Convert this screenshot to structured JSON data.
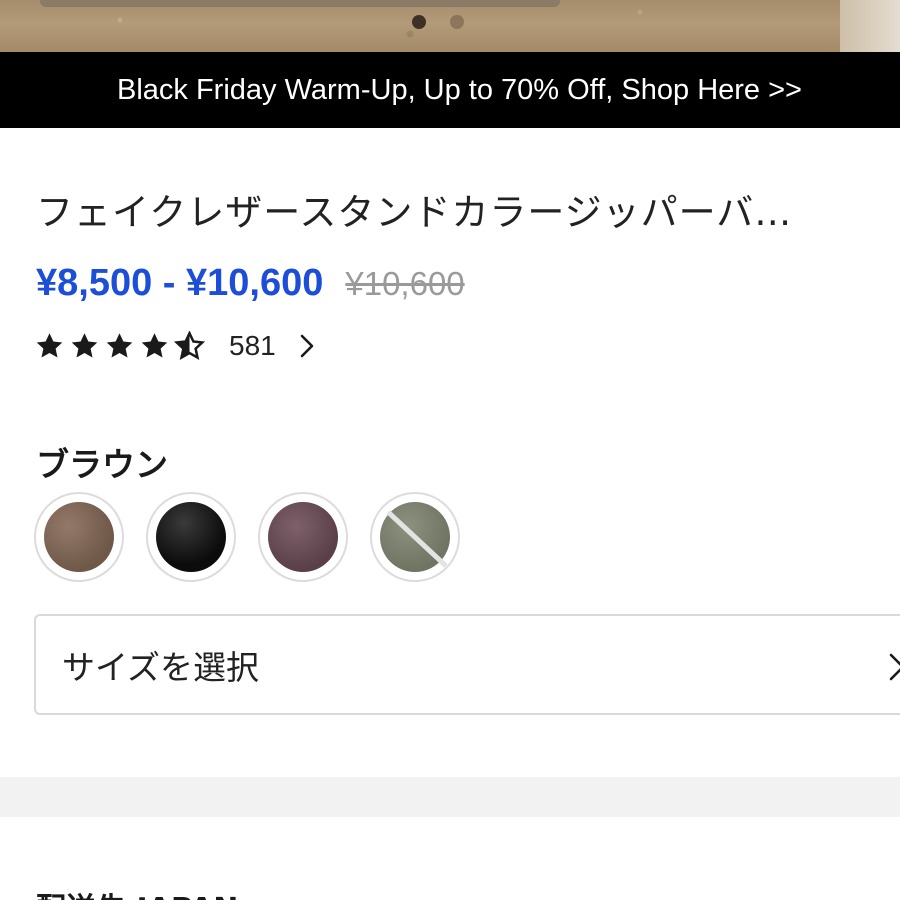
{
  "hero": {
    "dots": [
      true,
      false
    ]
  },
  "promo": {
    "text": "Black Friday Warm-Up, Up to 70% Off, Shop Here >>"
  },
  "product": {
    "title": "フェイクレザースタンドカラージッパーバ…",
    "price_range": "¥8,500 - ¥10,600",
    "original_price": "¥10,600",
    "rating": 4.5,
    "review_count": "581"
  },
  "color_selector": {
    "selected_label": "ブラウン",
    "swatches": [
      {
        "name": "brown",
        "color": "#7d6553",
        "available": true
      },
      {
        "name": "black",
        "color": "#111111",
        "available": true
      },
      {
        "name": "purple",
        "color": "#6b4d57",
        "available": true
      },
      {
        "name": "khaki",
        "color": "#7f8472",
        "available": false
      }
    ]
  },
  "size_selector": {
    "label": "サイズを選択"
  },
  "shipping": {
    "text": "配送先 JAPAN"
  },
  "colors": {
    "price": "#1d4ed8",
    "promo_bg": "#000000"
  }
}
